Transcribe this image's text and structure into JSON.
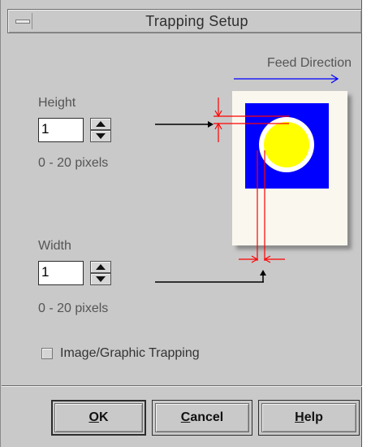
{
  "window": {
    "title": "Trapping Setup"
  },
  "diagram": {
    "feed_direction_label": "Feed Direction"
  },
  "height": {
    "label": "Height",
    "value": "1",
    "range": "0 - 20 pixels"
  },
  "width": {
    "label": "Width",
    "value": "1",
    "range": "0 - 20 pixels"
  },
  "image_graphic_trapping": {
    "label": "Image/Graphic Trapping",
    "checked": false
  },
  "buttons": {
    "ok": {
      "mnemonic": "O",
      "rest": "K"
    },
    "cancel": {
      "mnemonic": "C",
      "rest": "ancel"
    },
    "help": {
      "mnemonic": "H",
      "rest": "elp"
    }
  },
  "colors": {
    "page": "#faf8ee",
    "blue_box": "#0000ff",
    "circle": "#ffff00",
    "trap_lines": "#ff0000",
    "feed_arrow": "#0000ff"
  }
}
